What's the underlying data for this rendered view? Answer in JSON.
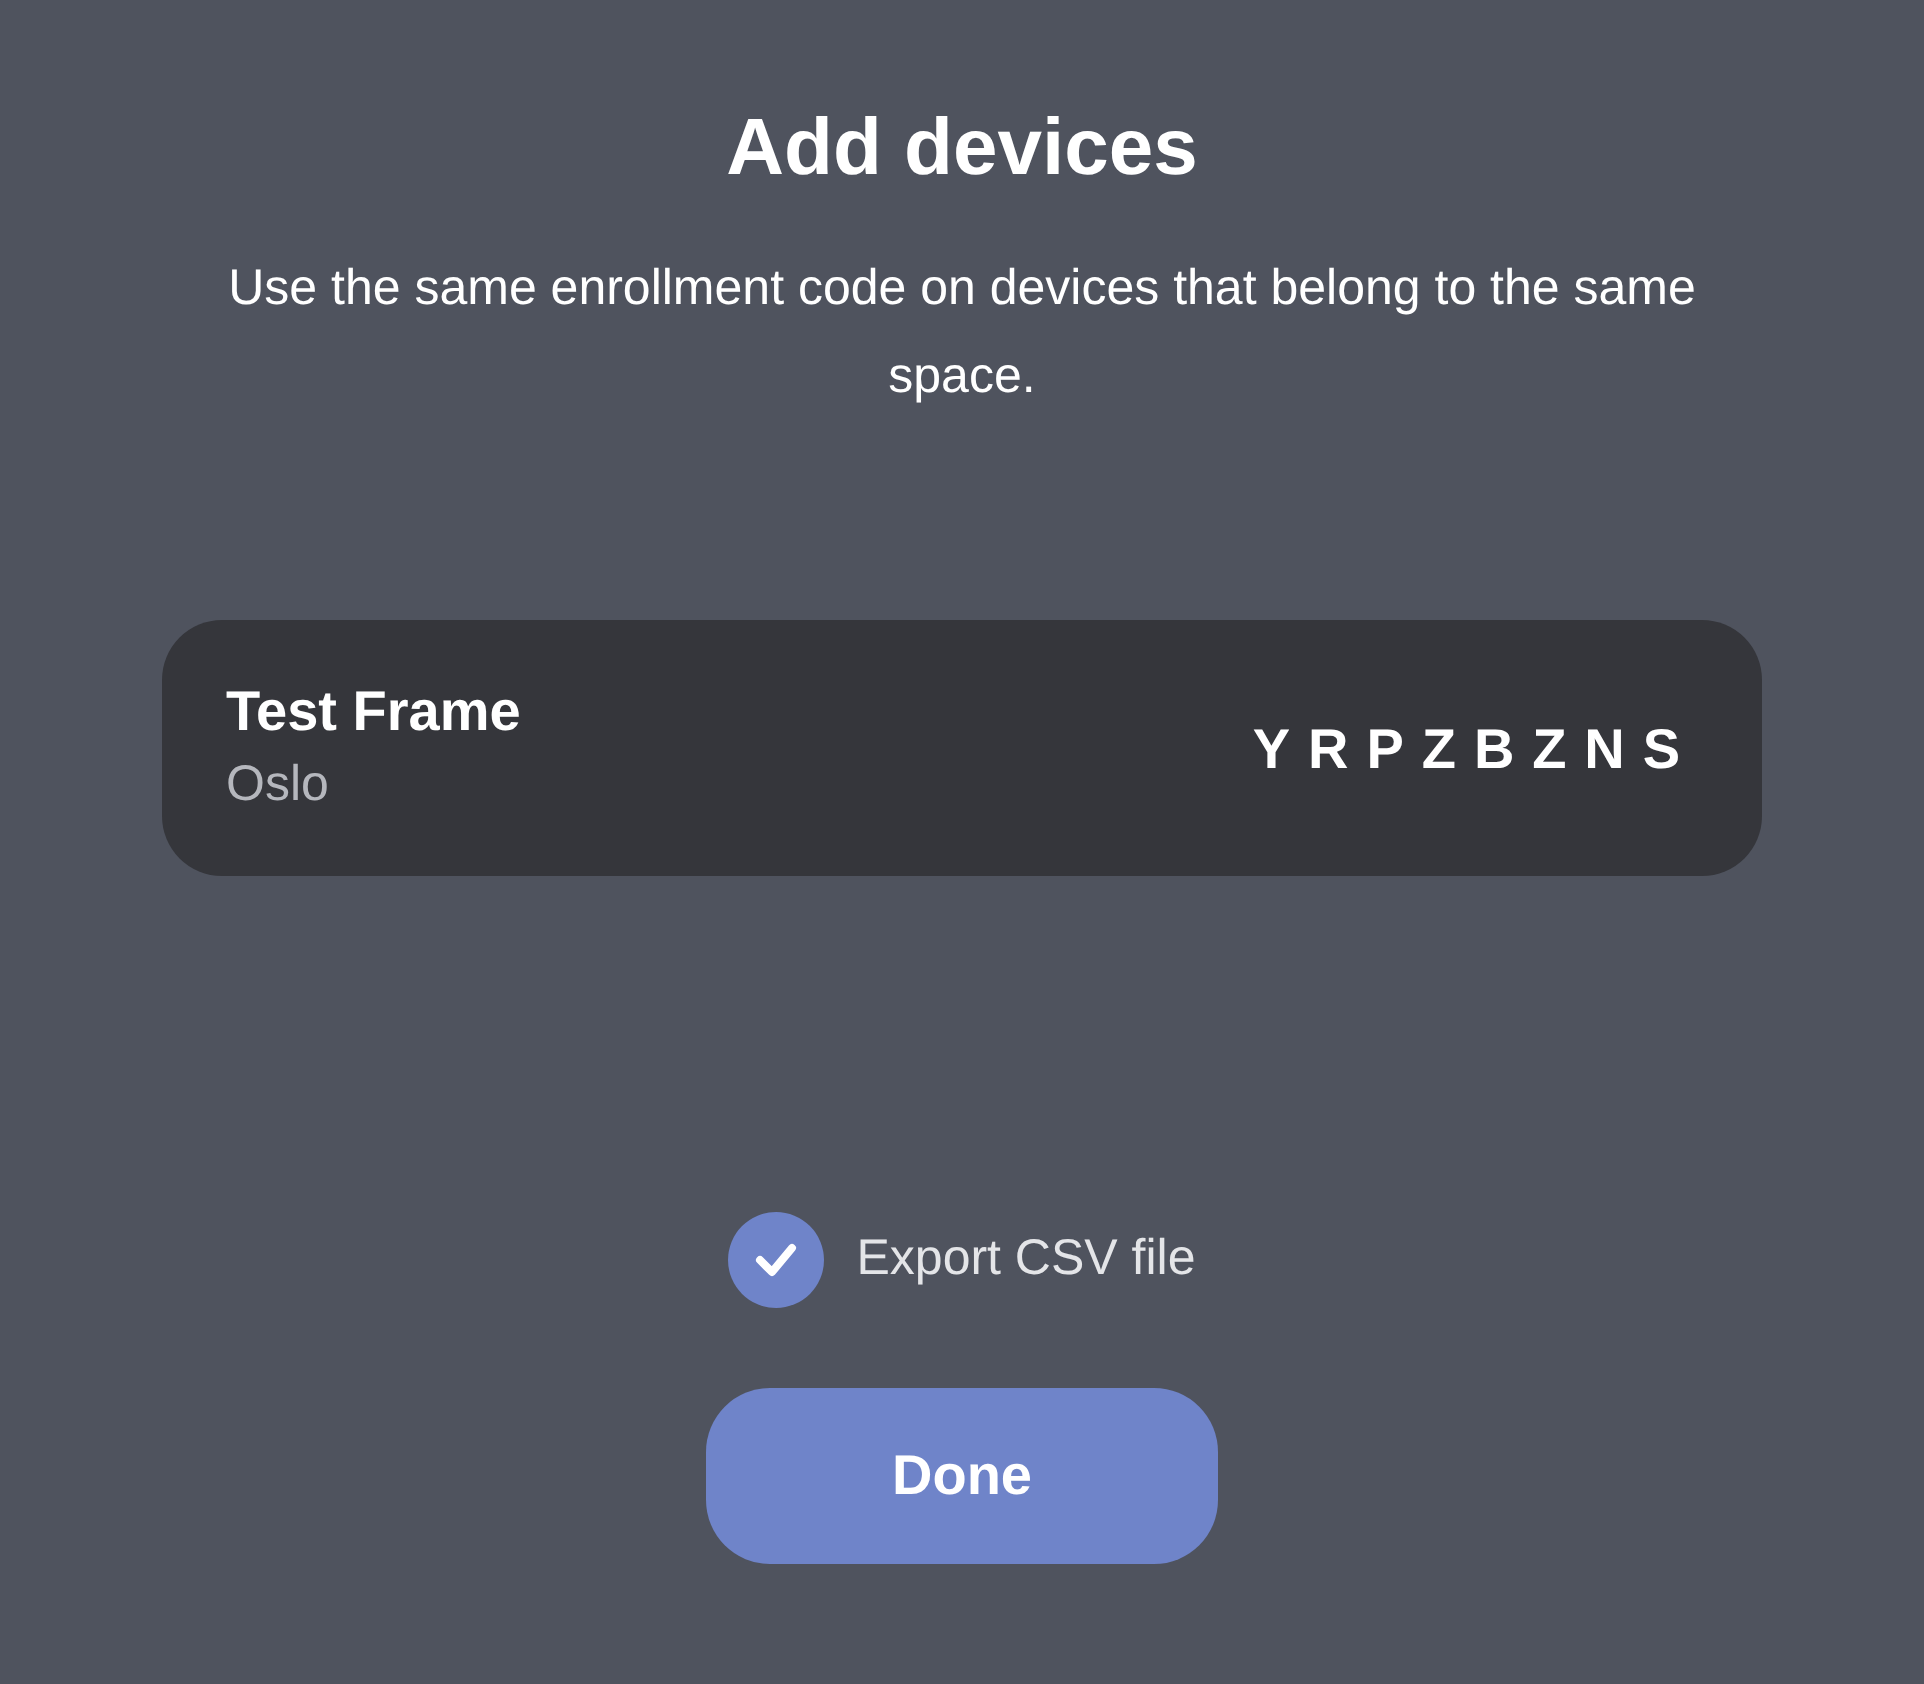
{
  "title": "Add devices",
  "description": "Use the same enrollment code on devices that belong to the same space.",
  "devices": [
    {
      "name": "Test Frame",
      "location": "Oslo",
      "code": "YRPZBZNS"
    }
  ],
  "export_csv": {
    "label": "Export CSV file",
    "checked": true
  },
  "buttons": [
    {
      "label": "Done"
    }
  ]
}
